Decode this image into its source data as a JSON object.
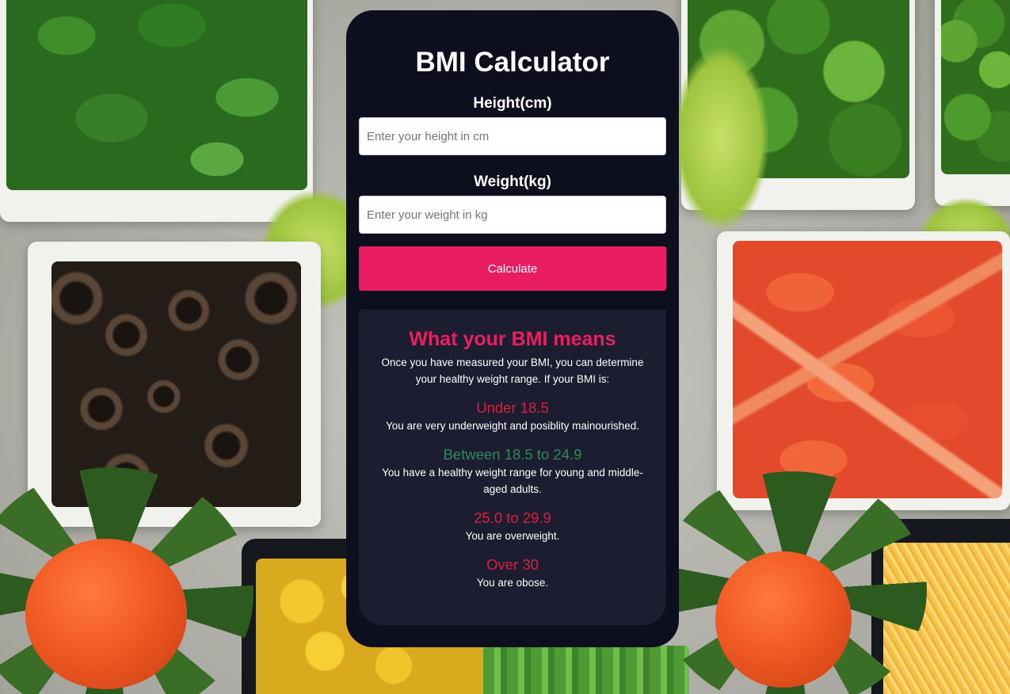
{
  "card": {
    "title": "BMI Calculator",
    "height_label": "Height(cm)",
    "height_placeholder": "Enter your height in cm",
    "height_value": "",
    "weight_label": "Weight(kg)",
    "weight_placeholder": "Enter your weight in kg",
    "weight_value": "",
    "calculate_label": "Calculate"
  },
  "info": {
    "heading": "What your BMI means",
    "intro": "Once you have measured your BMI, you can determine your healthy weight range. If your BMI is:",
    "ranges": [
      {
        "title": "Under 18.5",
        "description": "You are very underweight and posiblity mainourished.",
        "color": "#dc1f3f"
      },
      {
        "title": "Between 18.5 to 24.9",
        "description": "You have a healthy weight range for young and middle-aged adults.",
        "color": "#2e8b57"
      },
      {
        "title": "25.0 to 29.9",
        "description": "You are overweight.",
        "color": "#dc1f3f"
      },
      {
        "title": "Over 30",
        "description": "You are obose.",
        "color": "#dc1f3f"
      }
    ]
  },
  "colors": {
    "card_background": "#0d0f1f",
    "info_background": "#1c1d31",
    "accent": "#e81d62"
  }
}
